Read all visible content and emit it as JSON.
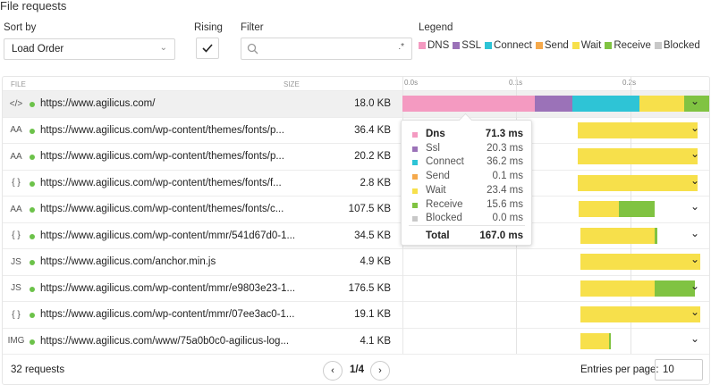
{
  "title": "File requests",
  "controls": {
    "sort_label": "Sort by",
    "sort_value": "Load Order",
    "rising_label": "Rising",
    "filter_label": "Filter",
    "filter_placeholder": "",
    "legend_label": "Legend"
  },
  "legend": [
    {
      "label": "DNS",
      "color": "#f49ac1"
    },
    {
      "label": "SSL",
      "color": "#9b72b8"
    },
    {
      "label": "Connect",
      "color": "#2ec4d6"
    },
    {
      "label": "Send",
      "color": "#f5a94b"
    },
    {
      "label": "Wait",
      "color": "#f7e04b"
    },
    {
      "label": "Receive",
      "color": "#80c342"
    },
    {
      "label": "Blocked",
      "color": "#c8c8c8"
    }
  ],
  "table": {
    "col_file": "FILE",
    "col_size": "SIZE",
    "ticks": [
      "0.0s",
      "0.1s",
      "0.2s"
    ],
    "rows": [
      {
        "icon": "html-file-icon",
        "glyph": "</>",
        "url": "https://www.agilicus.com/",
        "size": "18.0 KB"
      },
      {
        "icon": "font-file-icon",
        "glyph": "AA",
        "url": "https://www.agilicus.com/wp-content/themes/fonts/p...",
        "size": "36.4 KB"
      },
      {
        "icon": "font-file-icon",
        "glyph": "AA",
        "url": "https://www.agilicus.com/wp-content/themes/fonts/p...",
        "size": "20.2 KB"
      },
      {
        "icon": "json-file-icon",
        "glyph": "{ }",
        "url": "https://www.agilicus.com/wp-content/themes/fonts/f...",
        "size": "2.8 KB"
      },
      {
        "icon": "font-file-icon",
        "glyph": "AA",
        "url": "https://www.agilicus.com/wp-content/themes/fonts/c...",
        "size": "107.5 KB"
      },
      {
        "icon": "json-file-icon",
        "glyph": "{ }",
        "url": "https://www.agilicus.com/wp-content/mmr/541d67d0-1...",
        "size": "34.5 KB"
      },
      {
        "icon": "js-file-icon",
        "glyph": "JS",
        "url": "https://www.agilicus.com/anchor.min.js",
        "size": "4.9 KB"
      },
      {
        "icon": "js-file-icon",
        "glyph": "JS",
        "url": "https://www.agilicus.com/wp-content/mmr/e9803e23-1...",
        "size": "176.5 KB"
      },
      {
        "icon": "json-file-icon",
        "glyph": "{ }",
        "url": "https://www.agilicus.com/wp-content/mmr/07ee3ac0-1...",
        "size": "19.1 KB"
      },
      {
        "icon": "image-file-icon",
        "glyph": "IMG",
        "url": "https://www.agilicus.com/www/75a0b0c0-agilicus-log...",
        "size": "4.1 KB"
      }
    ]
  },
  "tooltip": {
    "rows": [
      {
        "name": "Dns",
        "value": "71.3 ms",
        "color": "#f49ac1"
      },
      {
        "name": "Ssl",
        "value": "20.3 ms",
        "color": "#9b72b8"
      },
      {
        "name": "Connect",
        "value": "36.2 ms",
        "color": "#2ec4d6"
      },
      {
        "name": "Send",
        "value": "0.1 ms",
        "color": "#f5a94b"
      },
      {
        "name": "Wait",
        "value": "23.4 ms",
        "color": "#f7e04b"
      },
      {
        "name": "Receive",
        "value": "15.6 ms",
        "color": "#80c342"
      },
      {
        "name": "Blocked",
        "value": "0.0 ms",
        "color": "#c8c8c8"
      }
    ],
    "total_label": "Total",
    "total_value": "167.0 ms"
  },
  "footer": {
    "count": "32 requests",
    "page": "1/4",
    "entries_label": "Entries per page:",
    "entries_value": "10"
  }
}
